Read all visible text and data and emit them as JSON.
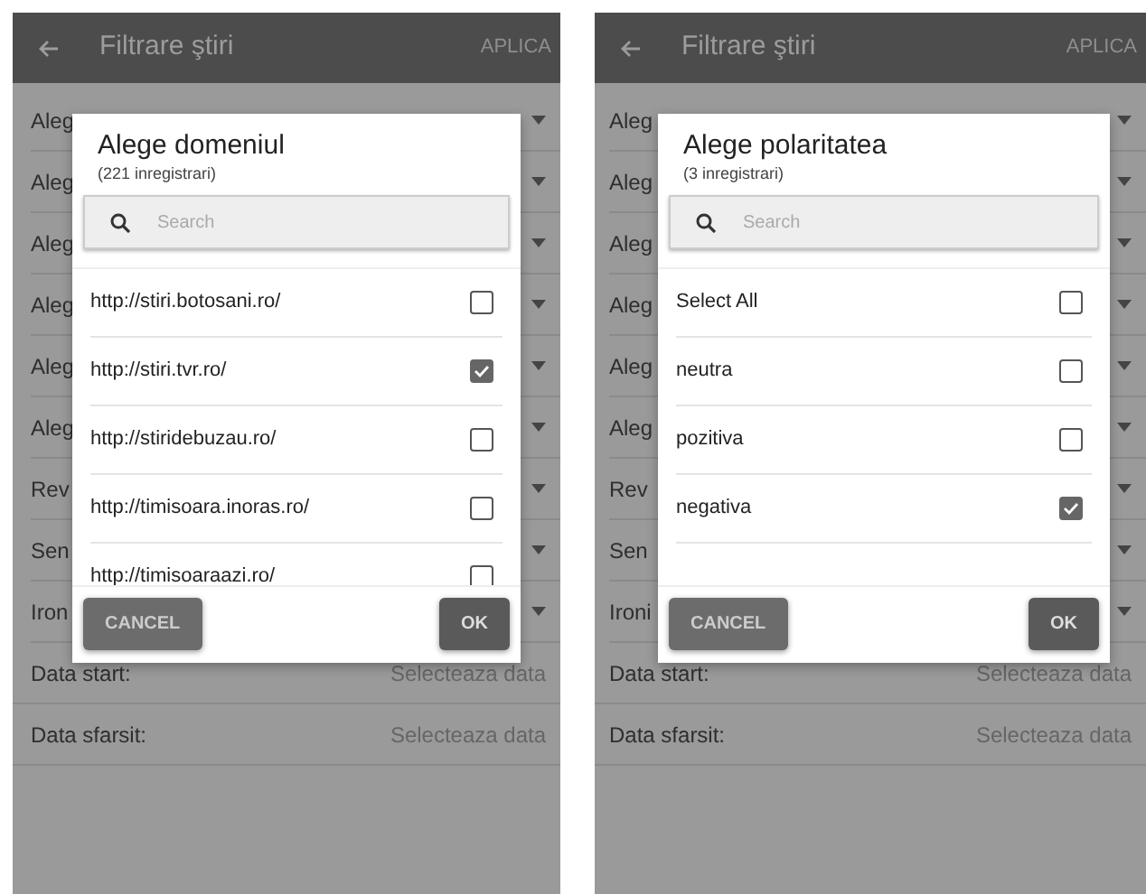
{
  "screens": [
    {
      "app_bar": {
        "title": "Filtrare ştiri",
        "action": "APLICA"
      },
      "filters": [
        {
          "kind": "dropdown",
          "label": "Aleg"
        },
        {
          "kind": "dropdown",
          "label": "Aleg"
        },
        {
          "kind": "dropdown",
          "label": "Aleg"
        },
        {
          "kind": "dropdown",
          "label": "Aleg"
        },
        {
          "kind": "dropdown",
          "label": "Aleg"
        },
        {
          "kind": "dropdown",
          "label": "Aleg"
        },
        {
          "kind": "dropdown",
          "label": "Rev"
        },
        {
          "kind": "dropdown",
          "label": "Sen"
        },
        {
          "kind": "dropdown",
          "label": "Iron"
        },
        {
          "kind": "date",
          "label": "Data start:",
          "value": "Selecteaza data"
        },
        {
          "kind": "date",
          "label": "Data sfarsit:",
          "value": "Selecteaza data"
        }
      ],
      "dialog": {
        "title": "Alege domeniul",
        "count": "(221 inregistrari)",
        "search": {
          "placeholder": "Search"
        },
        "items": [
          {
            "label": "http://stiri.botosani.ro/",
            "checked": false
          },
          {
            "label": "http://stiri.tvr.ro/",
            "checked": true
          },
          {
            "label": "http://stiridebuzau.ro/",
            "checked": false
          },
          {
            "label": "http://timisoara.inoras.ro/",
            "checked": false
          },
          {
            "label": "http://timisoaraazi.ro/",
            "checked": false
          }
        ],
        "buttons": [
          "CANCEL",
          "OK"
        ]
      }
    },
    {
      "app_bar": {
        "title": "Filtrare ştiri",
        "action": "APLICA"
      },
      "filters": [
        {
          "kind": "dropdown",
          "label": "Aleg"
        },
        {
          "kind": "dropdown",
          "label": "Aleg"
        },
        {
          "kind": "dropdown",
          "label": "Aleg"
        },
        {
          "kind": "dropdown",
          "label": "Aleg"
        },
        {
          "kind": "dropdown",
          "label": "Aleg"
        },
        {
          "kind": "dropdown",
          "label": "Aleg"
        },
        {
          "kind": "dropdown",
          "label": "Rev"
        },
        {
          "kind": "dropdown",
          "label": "Sen"
        },
        {
          "kind": "dropdown",
          "label": "Ironi"
        },
        {
          "kind": "date",
          "label": "Data start:",
          "value": "Selecteaza data"
        },
        {
          "kind": "date",
          "label": "Data sfarsit:",
          "value": "Selecteaza data"
        }
      ],
      "dialog": {
        "title": "Alege polaritatea",
        "count": "(3 inregistrari)",
        "search": {
          "placeholder": "Search"
        },
        "items": [
          {
            "label": "Select All",
            "checked": false
          },
          {
            "label": "neutra",
            "checked": false
          },
          {
            "label": "pozitiva",
            "checked": false
          },
          {
            "label": "negativa",
            "checked": true
          }
        ],
        "buttons": [
          "CANCEL",
          "OK"
        ]
      }
    }
  ]
}
